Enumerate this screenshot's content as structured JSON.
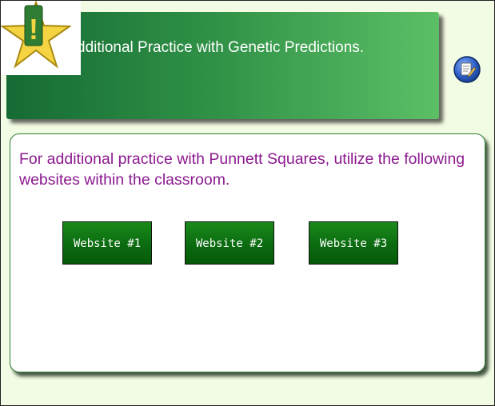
{
  "header": {
    "title": "dditional Practice with Genetic Predictions."
  },
  "badge": {
    "icon": "exclamation-star-icon",
    "symbol": "!"
  },
  "notes_button": {
    "icon": "notes-pencil-icon"
  },
  "content": {
    "intro": "For additional practice with Punnett Squares, utilize the following websites within the classroom.",
    "buttons": [
      {
        "label": "Website #1"
      },
      {
        "label": "Website #2"
      },
      {
        "label": "Website #3"
      }
    ]
  },
  "colors": {
    "background": "#f2fbe3",
    "banner_dark": "#156b34",
    "banner_light": "#5cbf66",
    "intro_text": "#8b1a8f",
    "button_green": "#0b6b10",
    "star_yellow": "#f5d443"
  }
}
